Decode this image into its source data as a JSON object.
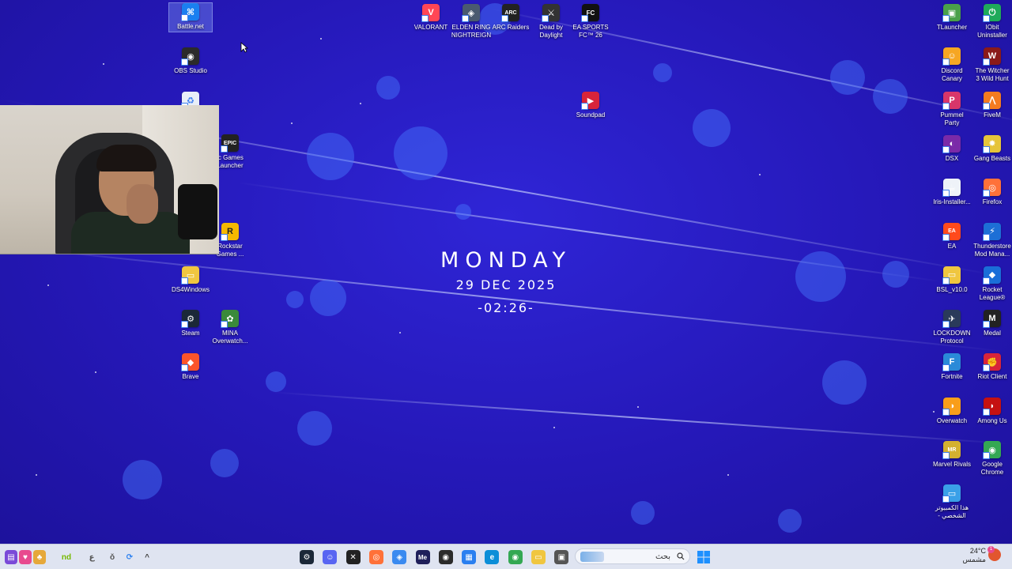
{
  "clock": {
    "day": "MONDAY",
    "date": "29 DEC 2025",
    "time": "-02:26-"
  },
  "desktop_icons_left": [
    {
      "name": "battlenet",
      "label": "Battle.net",
      "color": "#1a7ff0",
      "glyph": "⌘",
      "selected": true
    },
    {
      "name": "obs-studio",
      "label": "OBS Studio",
      "color": "#2b2b2b",
      "glyph": "◉"
    },
    {
      "name": "recycle-bin",
      "label": "",
      "color": "#e8eef8",
      "glyph": "♻"
    },
    {
      "name": "epic-games",
      "label": "ic Games\nLauncher",
      "color": "#222",
      "glyph": "EPIC"
    },
    {
      "name": "rockstar-games",
      "label": "Rockstar\nGames ...",
      "color": "#f5b800",
      "glyph": "R"
    },
    {
      "name": "ds4windows",
      "label": "DS4Windows",
      "color": "#f0c640",
      "glyph": "▭"
    },
    {
      "name": "steam",
      "label": "Steam",
      "color": "#1b2838",
      "glyph": "⚙"
    },
    {
      "name": "mina-overwatch",
      "label": "MINA\nOverwatch...",
      "color": "#3a8a3a",
      "glyph": "✿"
    },
    {
      "name": "brave",
      "label": "Brave",
      "color": "#fb542b",
      "glyph": "◆"
    }
  ],
  "desktop_icons_top": [
    {
      "name": "valorant",
      "label": "VALORANT",
      "color": "#ff4655",
      "glyph": "V"
    },
    {
      "name": "elden-ring",
      "label": "ELDEN RING\nNIGHTREIGN",
      "color": "#4a5a70",
      "glyph": "◈"
    },
    {
      "name": "arc-raiders",
      "label": "ARC Raiders",
      "color": "#222",
      "glyph": "ARC"
    },
    {
      "name": "dead-by-daylight",
      "label": "Dead by\nDaylight",
      "color": "#333",
      "glyph": "⚔"
    },
    {
      "name": "ea-sports-fc",
      "label": "EA SPORTS\nFC™ 26",
      "color": "#111",
      "glyph": "FC"
    },
    {
      "name": "soundpad",
      "label": "Soundpad",
      "color": "#d8243a",
      "glyph": "▶"
    }
  ],
  "desktop_icons_right": [
    {
      "name": "tlauncher",
      "label": "TLauncher",
      "color": "#4aa04a",
      "glyph": "▣"
    },
    {
      "name": "iobit-uninstaller",
      "label": "IObit\nUninstaller",
      "color": "#1faa5a",
      "glyph": "⏻"
    },
    {
      "name": "discord-canary",
      "label": "Discord\nCanary",
      "color": "#f6a623",
      "glyph": "☺"
    },
    {
      "name": "witcher-3",
      "label": "The Witcher\n3 Wild Hunt",
      "color": "#8a1a1a",
      "glyph": "W"
    },
    {
      "name": "pummel-party",
      "label": "Pummel\nParty",
      "color": "#d8366a",
      "glyph": "P"
    },
    {
      "name": "fivem",
      "label": "FiveM",
      "color": "#f47b20",
      "glyph": "⋀"
    },
    {
      "name": "dsx",
      "label": "DSX",
      "color": "#7a2aa8",
      "glyph": "◐"
    },
    {
      "name": "gang-beasts",
      "label": "Gang Beasts",
      "color": "#e6c43a",
      "glyph": "✸"
    },
    {
      "name": "iris-installer",
      "label": "Iris-Installer...",
      "color": "#eef2f8",
      "glyph": "☕"
    },
    {
      "name": "firefox",
      "label": "Firefox",
      "color": "#ff7139",
      "glyph": "◎"
    },
    {
      "name": "ea",
      "label": "EA",
      "color": "#ff4a1c",
      "glyph": "EA"
    },
    {
      "name": "thunderstore",
      "label": "Thunderstore\nMod Mana...",
      "color": "#1d6fd6",
      "glyph": "⚡"
    },
    {
      "name": "bsl-folder",
      "label": "BSL_v10.0",
      "color": "#f0c640",
      "glyph": "▭"
    },
    {
      "name": "rocket-league",
      "label": "Rocket\nLeague®",
      "color": "#1a6ed8",
      "glyph": "◆"
    },
    {
      "name": "lockdown-protocol",
      "label": "LOCKDOWN\nProtocol",
      "color": "#2a3a5a",
      "glyph": "✈"
    },
    {
      "name": "medal",
      "label": "Medal",
      "color": "#222",
      "glyph": "M"
    },
    {
      "name": "fortnite",
      "label": "Fortnite",
      "color": "#2a8ad8",
      "glyph": "F"
    },
    {
      "name": "riot-client",
      "label": "Riot Client",
      "color": "#d8243a",
      "glyph": "✊"
    },
    {
      "name": "overwatch",
      "label": "Overwatch",
      "color": "#f99e1a",
      "glyph": "◑"
    },
    {
      "name": "among-us",
      "label": "Among Us",
      "color": "#c51111",
      "glyph": "◗"
    },
    {
      "name": "marvel-rivals",
      "label": "Marvel Rivals",
      "color": "#d4b030",
      "glyph": "MR"
    },
    {
      "name": "google-chrome",
      "label": "Google\nChrome",
      "color": "#34a853",
      "glyph": "◉"
    },
    {
      "name": "this-pc",
      "label": "هذا الكمبيوتر\n- الشخصي",
      "color": "#3aa0e8",
      "glyph": "▭"
    }
  ],
  "taskbar": {
    "search_placeholder": "بحث",
    "weather_temp": "24°C",
    "weather_desc": "مشمس",
    "notification_count": "1",
    "pinned": [
      {
        "name": "steam",
        "color": "#1b2838",
        "glyph": "⚙"
      },
      {
        "name": "discord",
        "color": "#5865f2",
        "glyph": "☺"
      },
      {
        "name": "capcut",
        "color": "#222",
        "glyph": "✕"
      },
      {
        "name": "firefox",
        "color": "#ff7139",
        "glyph": "◎"
      },
      {
        "name": "copilot",
        "color": "#3a8af0",
        "glyph": "◈"
      },
      {
        "name": "media-encoder",
        "color": "#1f1f5a",
        "glyph": "Me"
      },
      {
        "name": "obs",
        "color": "#2b2b2b",
        "glyph": "◉"
      },
      {
        "name": "store",
        "color": "#2a7ff0",
        "glyph": "▦"
      },
      {
        "name": "edge",
        "color": "#0c8ed8",
        "glyph": "e"
      },
      {
        "name": "chrome",
        "color": "#34a853",
        "glyph": "◉"
      },
      {
        "name": "file-explorer",
        "color": "#f0c640",
        "glyph": "▭"
      },
      {
        "name": "task-view",
        "color": "#555",
        "glyph": "▣"
      }
    ],
    "tray_left": [
      {
        "name": "app-tray-1",
        "color": "#7a4ad8",
        "glyph": "▤"
      },
      {
        "name": "app-tray-heart",
        "color": "#e84a8f",
        "glyph": "♥"
      },
      {
        "name": "app-tray-3",
        "color": "#e6a83a",
        "glyph": "♣"
      },
      {
        "name": "app-tray-nvidia",
        "color": "#76b900",
        "glyph": "nd"
      },
      {
        "name": "app-tray-5",
        "color": "#555",
        "glyph": "ع"
      },
      {
        "name": "microphone",
        "color": "#555",
        "glyph": "ǒ"
      },
      {
        "name": "sync",
        "color": "#2a7ff0",
        "glyph": "⟳"
      },
      {
        "name": "tray-overflow",
        "color": "#444",
        "glyph": "^"
      }
    ]
  }
}
